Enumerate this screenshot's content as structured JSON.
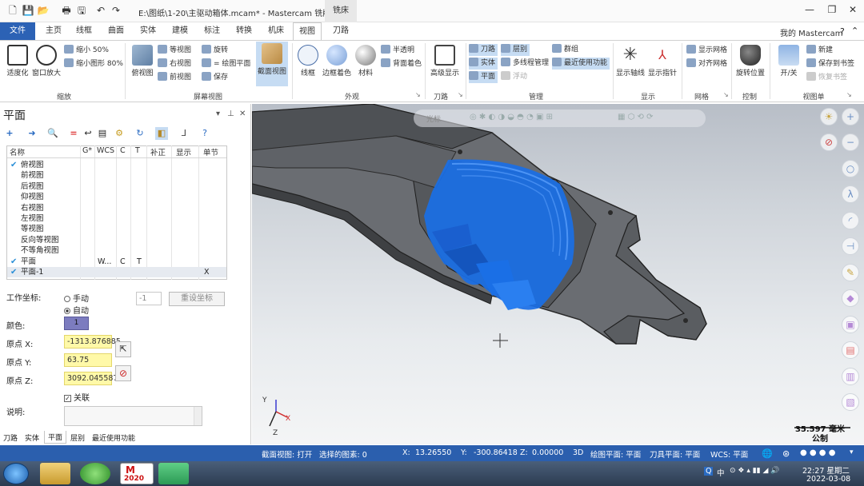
{
  "title_bar": {
    "title": "E:\\图纸\\1-20\\主驱动箱体.mcam* - Mastercam 铣削 2020",
    "context_tab": "铣床",
    "minimize": "—",
    "restore": "❐",
    "close": "✕"
  },
  "menu_tabs": {
    "file": "文件",
    "items": [
      "主页",
      "线框",
      "曲面",
      "实体",
      "建模",
      "标注",
      "转换",
      "机床",
      "视图",
      "刀路"
    ],
    "active": "视图"
  },
  "user": "我的 Mastercam",
  "ribbon": {
    "zoom_group": {
      "label": "缩放",
      "fit": "适度化",
      "window_zoom": "窗口放大",
      "zoom_out_50": "缩小 50%",
      "zoom_out_80": "缩小图形 80%"
    },
    "screen_view_group": {
      "label": "屏幕视图",
      "top": "俯视图",
      "iso": "等视图",
      "right": "右视图",
      "front": "前视图",
      "rotate": "旋转",
      "plane_view": "= 绘图平面",
      "save": "保存",
      "section_view": "截面视图"
    },
    "appearance_group": {
      "label": "外观",
      "wireframe": "线框",
      "edge_shade": "边框着色",
      "material": "材料",
      "translucent": "半透明",
      "back_color": "背面着色"
    },
    "toolpath_group": {
      "label": "刀路",
      "advanced_display": "高级显示"
    },
    "manage_group": {
      "label": "管理",
      "toolpaths": "刀路",
      "solids": "实体",
      "planes": "平面",
      "levels": "层别",
      "multithread": "多线程管理",
      "float": "浮动",
      "groups": "群组",
      "recent": "最近使用功能"
    },
    "display_group": {
      "label": "显示",
      "axes": "显示轴线",
      "gnomons": "显示指针"
    },
    "grid_group": {
      "label": "网格",
      "show_grid": "显示网格",
      "snap_grid": "对齐网格"
    },
    "control_group": {
      "label": "控制",
      "rotate_pos": "旋转位置"
    },
    "viewsheet_group": {
      "label": "视图单",
      "toggle": "开/关",
      "new": "新建",
      "save_bookmark": "保存到书签",
      "restore_bookmark": "恢复书签"
    }
  },
  "planes_panel": {
    "title": "平面",
    "pin": "📌",
    "close": "✕",
    "columns": [
      "名称",
      "G*",
      "WCS",
      "C",
      "T",
      "补正",
      "显示",
      "单节"
    ],
    "rows": [
      {
        "name": "俯视图",
        "checked": true,
        "g": "",
        "wcs": "",
        "c": "",
        "t": "",
        "sect": ""
      },
      {
        "name": "前视图",
        "checked": false,
        "g": "",
        "wcs": "",
        "c": "",
        "t": "",
        "sect": ""
      },
      {
        "name": "后视图",
        "checked": false,
        "g": "",
        "wcs": "",
        "c": "",
        "t": "",
        "sect": ""
      },
      {
        "name": "仰视图",
        "checked": false,
        "g": "",
        "wcs": "",
        "c": "",
        "t": "",
        "sect": ""
      },
      {
        "name": "右视图",
        "checked": false,
        "g": "",
        "wcs": "",
        "c": "",
        "t": "",
        "sect": ""
      },
      {
        "name": "左视图",
        "checked": false,
        "g": "",
        "wcs": "",
        "c": "",
        "t": "",
        "sect": ""
      },
      {
        "name": "等视图",
        "checked": false,
        "g": "",
        "wcs": "",
        "c": "",
        "t": "",
        "sect": ""
      },
      {
        "name": "反向等视图",
        "checked": false,
        "g": "",
        "wcs": "",
        "c": "",
        "t": "",
        "sect": ""
      },
      {
        "name": "不等角视图",
        "checked": false,
        "g": "",
        "wcs": "",
        "c": "",
        "t": "",
        "sect": ""
      },
      {
        "name": "平面",
        "checked": true,
        "g": "",
        "wcs": "W...",
        "c": "C",
        "t": "T",
        "sect": ""
      },
      {
        "name": "平面-1",
        "checked": true,
        "g": "",
        "wcs": "",
        "c": "",
        "t": "",
        "sect": "X"
      }
    ],
    "work_coord_label": "工作坐标:",
    "manual": "手动",
    "auto": "自动",
    "coord_value": "-1",
    "reset_button": "重设坐标",
    "color_label": "颜色:",
    "color_value": "1",
    "origin_x_label": "原点 X:",
    "origin_x": "-1313.876885",
    "origin_y_label": "原点 Y:",
    "origin_y": "63.75",
    "origin_z_label": "原点 Z:",
    "origin_z": "3092.045587",
    "link_label": "关联",
    "desc_label": "说明:",
    "bottom_tabs": [
      "刀路",
      "实体",
      "平面",
      "层别",
      "最近使用功能"
    ],
    "active_bottom_tab": "平面"
  },
  "viewport": {
    "scale": "35.597 毫米",
    "unit": "公制",
    "toolbar_label": "光标"
  },
  "status_bar": {
    "section_view": "截面视图: 打开",
    "selected": "选择的图素: 0",
    "x_label": "X:",
    "x": "13.26550",
    "y_label": "Y:",
    "y": "-300.86418",
    "z_label": "Z:",
    "z": "0.00000",
    "mode": "3D",
    "draw_plane": "绘图平面: 平面",
    "tool_plane": "刀具平面: 平面",
    "wcs": "WCS: 平面"
  },
  "taskbar": {
    "time": "22:27 星期二",
    "date": "2022-03-08",
    "ime": "中",
    "mc_label": "2020"
  },
  "colors": {
    "accent": "#2c62b5",
    "toolpath": "#1a6fe6",
    "part": "#5a5d62",
    "status": "#2b5fae"
  }
}
